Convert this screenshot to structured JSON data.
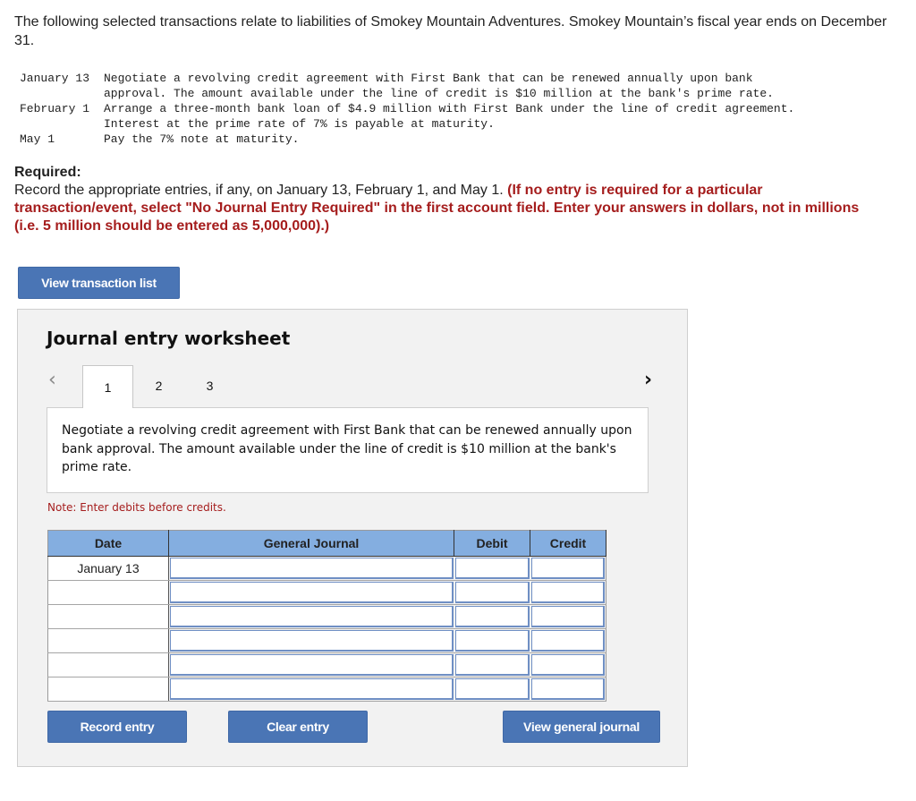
{
  "intro": "The following selected transactions relate to liabilities of Smokey Mountain Adventures. Smokey Mountain’s fiscal year ends on December 31.",
  "transactions": [
    {
      "date": "January 13",
      "description": "Negotiate a revolving credit agreement with First Bank that can be renewed annually upon bank\napproval. The amount available under the line of credit is $10 million at the bank's prime rate."
    },
    {
      "date": "February 1",
      "description": "Arrange a three-month bank loan of $4.9 million with First Bank under the line of credit agreement.\nInterest at the prime rate of 7% is payable at maturity."
    },
    {
      "date": "May 1",
      "description": "Pay the 7% note at maturity."
    }
  ],
  "required": {
    "title": "Required:",
    "text": "Record the appropriate entries, if any, on January 13, February 1, and May 1. ",
    "instructions": "(If no entry is required for a particular transaction/event, select \"No Journal Entry Required\" in the first account field. Enter your answers in dollars, not in millions (i.e. 5 million should be entered as 5,000,000).)"
  },
  "buttons": {
    "view_transaction_list": "View transaction list",
    "record_entry": "Record entry",
    "clear_entry": "Clear entry",
    "view_general_journal": "View general journal"
  },
  "worksheet": {
    "title": "Journal entry worksheet",
    "nav_prev": "‹",
    "nav_next": "›",
    "tabs": [
      "1",
      "2",
      "3"
    ],
    "active_tab": "1",
    "description": "Negotiate a revolving credit agreement with First Bank that can be renewed annually upon bank approval. The amount available under the line of credit is $10 million at the bank's prime rate.",
    "note": "Note: Enter debits before credits.",
    "table": {
      "headers": [
        "Date",
        "General Journal",
        "Debit",
        "Credit"
      ],
      "rows": [
        {
          "date": "January 13",
          "account": "",
          "debit": "",
          "credit": ""
        },
        {
          "date": "",
          "account": "",
          "debit": "",
          "credit": ""
        },
        {
          "date": "",
          "account": "",
          "debit": "",
          "credit": ""
        },
        {
          "date": "",
          "account": "",
          "debit": "",
          "credit": ""
        },
        {
          "date": "",
          "account": "",
          "debit": "",
          "credit": ""
        },
        {
          "date": "",
          "account": "",
          "debit": "",
          "credit": ""
        }
      ]
    }
  },
  "colors": {
    "button": "#4a75b5",
    "table_header": "#84aee0",
    "instruction_red": "#a51d1d",
    "input_marker": "#3d6cc0"
  }
}
